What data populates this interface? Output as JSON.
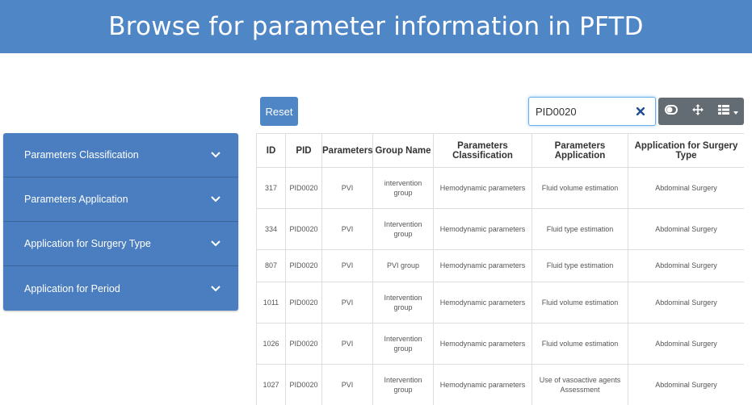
{
  "header": {
    "title": "Browse for parameter information in PFTD"
  },
  "sidebar": {
    "items": [
      {
        "label": "Parameters Classification"
      },
      {
        "label": "Parameters Application"
      },
      {
        "label": "Application for Surgery Type"
      },
      {
        "label": "Application for Period"
      }
    ]
  },
  "toolbar": {
    "reset_label": "Reset",
    "search_value": "PID0020",
    "clear_icon": "close-icon",
    "tool_icons": [
      "toggle-icon",
      "move-arrows-icon",
      "column-grid-icon"
    ]
  },
  "table": {
    "columns": [
      "ID",
      "PID",
      "Parameters",
      "Group Name",
      "Parameters Classification",
      "Parameters Application",
      "Application for Surgery Type"
    ],
    "rows": [
      [
        "317",
        "PID0020",
        "PVI",
        "intervention group",
        "Hemodynamic parameters",
        "Fluid volume estimation",
        "Abdominal Surgery"
      ],
      [
        "334",
        "PID0020",
        "PVI",
        "Intervention group",
        "Hemodynamic parameters",
        "Fluid type estimation",
        "Abdominal Surgery"
      ],
      [
        "807",
        "PID0020",
        "PVI",
        "PVI group",
        "Hemodynamic parameters",
        "Fluid type estimation",
        "Abdominal Surgery"
      ],
      [
        "1011",
        "PID0020",
        "PVI",
        "Intervention group",
        "Hemodynamic parameters",
        "Fluid volume estimation",
        "Abdominal Surgery"
      ],
      [
        "1026",
        "PID0020",
        "PVI",
        "Intervention group",
        "Hemodynamic parameters",
        "Fluid volume estimation",
        "Abdominal Surgery"
      ],
      [
        "1027",
        "PID0020",
        "PVI",
        "Intervention group",
        "Hemodynamic parameters",
        "Use of vasoactive agents Assessment",
        "Abdominal Surgery"
      ]
    ]
  },
  "colors": {
    "banner": "#4f86c6",
    "sidebar": "#4a7ec0",
    "toolbar": "#636b73",
    "clear_x": "#1f4e8c"
  }
}
